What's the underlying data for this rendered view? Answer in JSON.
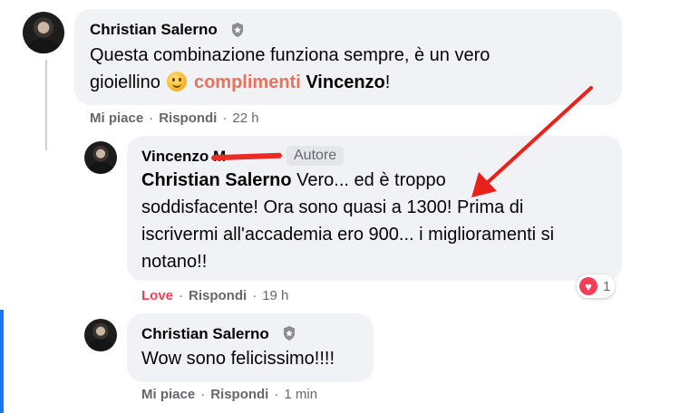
{
  "comments": [
    {
      "author": "Christian Salerno",
      "text_line1": "Questa combinazione funziona sempre, è un vero",
      "text_line2_a": "gioiellino",
      "text_line2_highlight": "complimenti",
      "text_line2_mention": "Vincenzo",
      "text_line2_end": "!",
      "action_like": "Mi piace",
      "action_reply": "Rispondi",
      "time": "22 h",
      "sep": "·"
    },
    {
      "author": "Vincenzo M",
      "author_badge": "Autore",
      "mention": "Christian Salerno",
      "text_line1": " Vero... ed è troppo",
      "text_line2": "soddisfacente! Ora sono quasi a 1300! Prima di",
      "text_line3": "iscrivermi all'accademia ero 900... i miglioramenti si",
      "text_line4": "notano!!",
      "reaction_count": "1",
      "action_like": "Love",
      "action_reply": "Rispondi",
      "time": "19 h",
      "sep": "·"
    },
    {
      "author": "Christian Salerno",
      "text_line1": "Wow sono felicissimo!!!!",
      "action_like": "Mi piace",
      "action_reply": "Rispondi",
      "time": "1 min",
      "sep": "·"
    }
  ],
  "colors": {
    "bubble": "#f0f2f5",
    "highlight": "#e8725a",
    "love": "#f33e58",
    "annotation_arrow": "#e8221b",
    "accent": "#1877f2"
  }
}
